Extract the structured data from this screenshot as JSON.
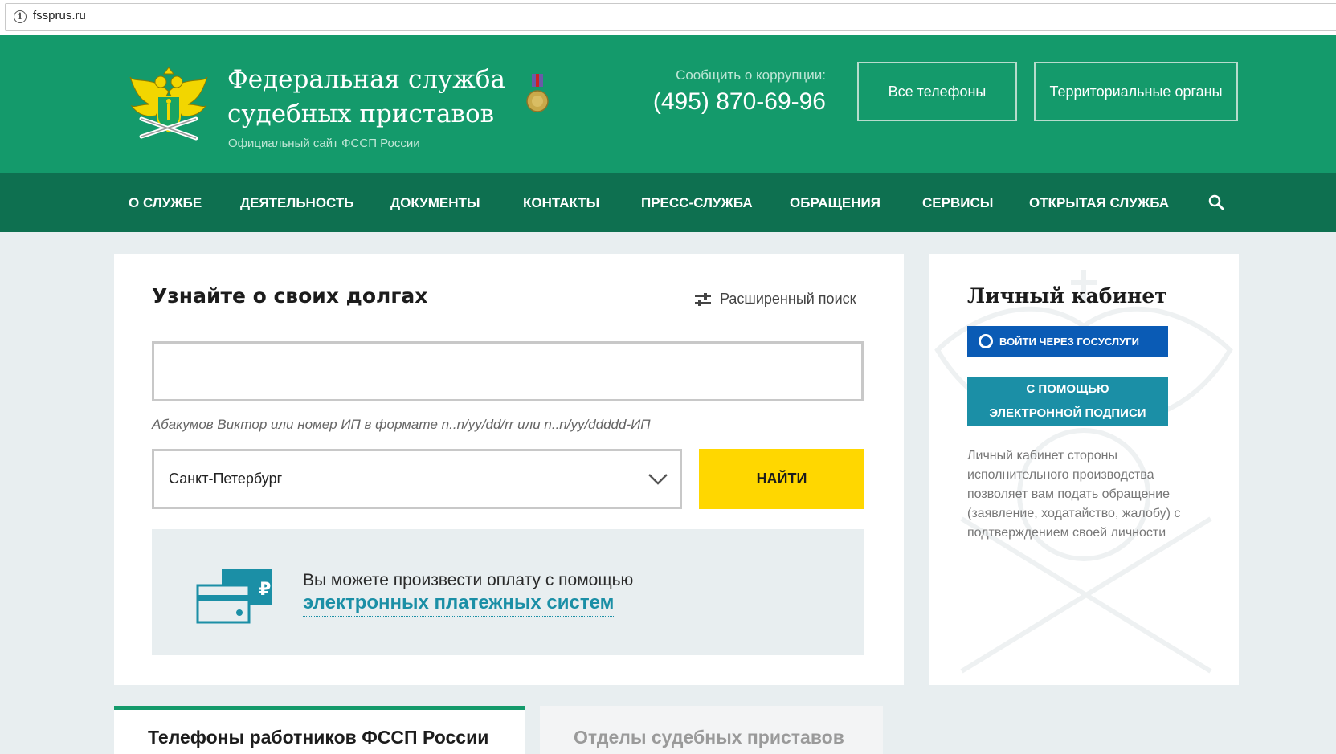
{
  "browser": {
    "url": "fssprus.ru"
  },
  "header": {
    "title_line1": "Федеральная служба",
    "title_line2": "судебных приставов",
    "subtitle": "Официальный сайт ФССП России",
    "corruption_label": "Сообщить о коррупции:",
    "corruption_phone": "(495) 870-69-96",
    "all_phones_label": "Все телефоны",
    "territorial_label": "Территориальные органы"
  },
  "nav": {
    "items": [
      {
        "label": "О СЛУЖБЕ"
      },
      {
        "label": "ДЕЯТЕЛЬНОСТЬ"
      },
      {
        "label": "ДОКУМЕНТЫ"
      },
      {
        "label": "КОНТАКТЫ"
      },
      {
        "label": "ПРЕСС-СЛУЖБА"
      },
      {
        "label": "ОБРАЩЕНИЯ"
      },
      {
        "label": "СЕРВИСЫ"
      },
      {
        "label": "ОТКРЫТАЯ СЛУЖБА"
      }
    ],
    "search_icon": "search-icon"
  },
  "debt": {
    "title": "Узнайте о своих долгах",
    "advanced_search_label": "Расширенный поиск",
    "search_value": "",
    "hint": "Абакумов Виктор или номер ИП в формате n..n/yy/dd/rr или n..n/yy/ddddd-ИП",
    "region_value": "Санкт-Петербург",
    "find_label": "НАЙТИ",
    "payment_text": "Вы можете произвести оплату с помощью",
    "payment_link": "электронных платежных систем"
  },
  "cabinet": {
    "title": "Личный кабинет",
    "gosuslugi_label": "ВОЙТИ ЧЕРЕЗ ГОСУСЛУГИ",
    "esign_line1": "С ПОМОЩЬЮ",
    "esign_line2": "ЭЛЕКТРОННОЙ ПОДПИСИ",
    "description": "Личный кабинет стороны исполнительного производства позволяет вам подать обращение (заявление, ходатайство, жалобу) с подтверждением своей личности"
  },
  "bottom_tabs": [
    {
      "label": "Телефоны работников ФССП России"
    },
    {
      "label": "Отделы судебных приставов"
    }
  ],
  "colors": {
    "header_green": "#149a6b",
    "nav_green": "#0e7050",
    "find_yellow": "#ffd700",
    "gosuslugi_blue": "#0a5bb5",
    "teal": "#1b8fa6"
  }
}
